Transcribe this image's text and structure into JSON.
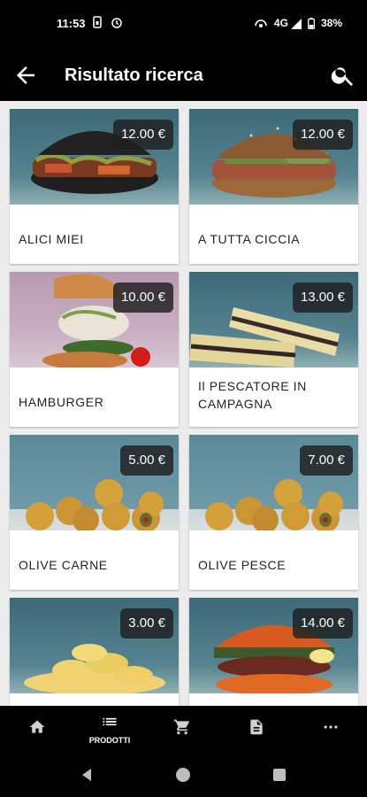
{
  "status_bar": {
    "time": "11:53",
    "network": "4G",
    "battery": "38%"
  },
  "app_bar": {
    "title": "Risultato ricerca",
    "back_icon": "arrow-back-icon",
    "search_icon": "search-icon"
  },
  "products": [
    {
      "name": "ALICI MIEI",
      "price": "12.00 €",
      "image": "dark-bun-burger"
    },
    {
      "name": "A TUTTA CICCIA",
      "price": "12.00 €",
      "image": "seeded-bun-burger"
    },
    {
      "name": "HAMBURGER",
      "price": "10.00 €",
      "image": "fish-burger-deconstructed"
    },
    {
      "name": "Il PESCATORE IN CAMPAGNA",
      "price": "13.00 €",
      "image": "focaccia-sandwich"
    },
    {
      "name": "OLIVE CARNE",
      "price": "5.00 €",
      "image": "fried-olives"
    },
    {
      "name": "OLIVE PESCE",
      "price": "7.00 €",
      "image": "fried-olives"
    },
    {
      "name": "",
      "price": "3.00 €",
      "image": "potato-chips"
    },
    {
      "name": "",
      "price": "14.00 €",
      "image": "octopus-burger"
    }
  ],
  "bottom_nav": {
    "items": [
      {
        "icon": "home-icon",
        "label": ""
      },
      {
        "icon": "list-icon",
        "label": "PRODOTTI"
      },
      {
        "icon": "cart-icon",
        "label": ""
      },
      {
        "icon": "document-icon",
        "label": ""
      },
      {
        "icon": "more-icon",
        "label": ""
      }
    ]
  }
}
